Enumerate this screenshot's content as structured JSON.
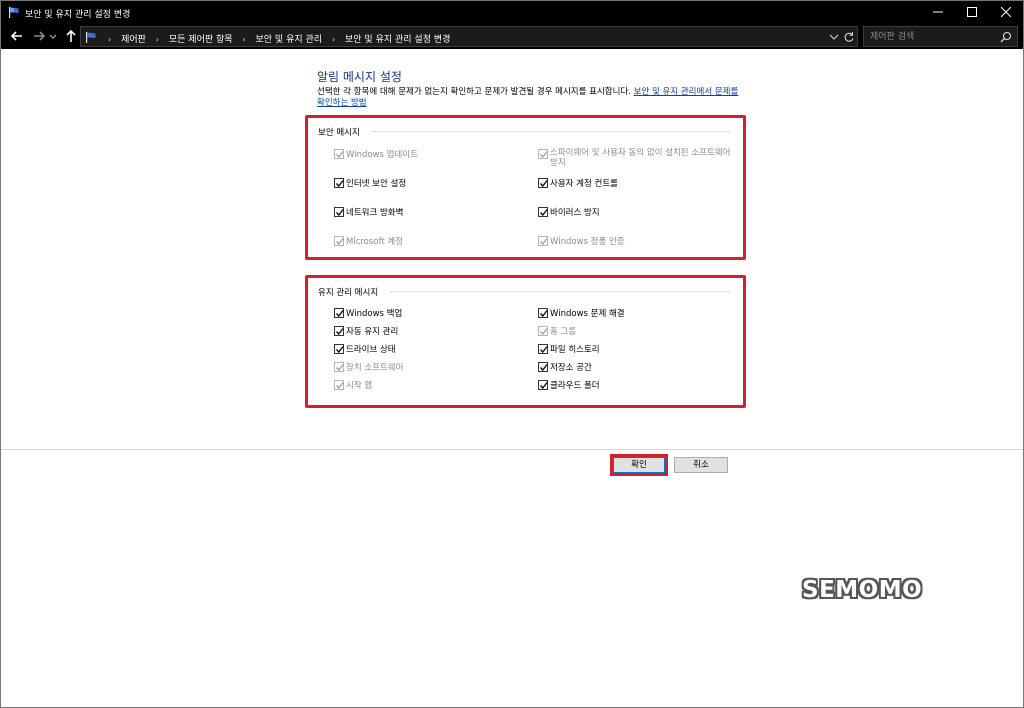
{
  "window": {
    "title": "보안 및 유지 관리 설정 변경"
  },
  "nav": {
    "breadcrumbs": [
      "제어판",
      "모든 제어판 항목",
      "보안 및 유지 관리",
      "보안 및 유지 관리 설정 변경"
    ],
    "search_placeholder": "제어판 검색"
  },
  "content": {
    "heading": "알림 메시지 설정",
    "intro_text": "선택한 각 항목에 대해 문제가 없는지 확인하고 문제가 발견될 경우 메시지를 표시합니다. ",
    "intro_link": "보안 및 유지 관리에서 문제를 확인하는 방법"
  },
  "security": {
    "title": "보안 메시지",
    "items": [
      {
        "label": "Windows 업데이트",
        "checked": true,
        "enabled": false
      },
      {
        "label": "스파이웨어 및 사용자 동의 없이 설치된 소프트웨어 방지",
        "checked": true,
        "enabled": false
      },
      {
        "label": "인터넷 보안 설정",
        "checked": true,
        "enabled": true
      },
      {
        "label": "사용자 계정 컨트롤",
        "checked": true,
        "enabled": true
      },
      {
        "label": "네트워크 방화벽",
        "checked": true,
        "enabled": true
      },
      {
        "label": "바이러스 방지",
        "checked": true,
        "enabled": true
      },
      {
        "label": "Microsoft 계정",
        "checked": true,
        "enabled": false
      },
      {
        "label": "Windows 정품 인증",
        "checked": true,
        "enabled": false
      }
    ]
  },
  "maintenance": {
    "title": "유지 관리 메시지",
    "items": [
      {
        "label": "Windows 백업",
        "checked": true,
        "enabled": true
      },
      {
        "label": "Windows 문제 해결",
        "checked": true,
        "enabled": true
      },
      {
        "label": "자동 유지 관리",
        "checked": true,
        "enabled": true
      },
      {
        "label": "홈 그룹",
        "checked": true,
        "enabled": false
      },
      {
        "label": "드라이브 상태",
        "checked": true,
        "enabled": true
      },
      {
        "label": "파일 히스토리",
        "checked": true,
        "enabled": true
      },
      {
        "label": "장치 소프트웨어",
        "checked": true,
        "enabled": false
      },
      {
        "label": "저장소 공간",
        "checked": true,
        "enabled": true
      },
      {
        "label": "시작 앱",
        "checked": true,
        "enabled": false
      },
      {
        "label": "클라우드 폴더",
        "checked": true,
        "enabled": true
      }
    ]
  },
  "buttons": {
    "ok": "확인",
    "cancel": "취소"
  },
  "watermark": "SEMOMO",
  "colors": {
    "highlight": "#d3212c",
    "heading": "#1e3287",
    "link": "#0645ad"
  }
}
